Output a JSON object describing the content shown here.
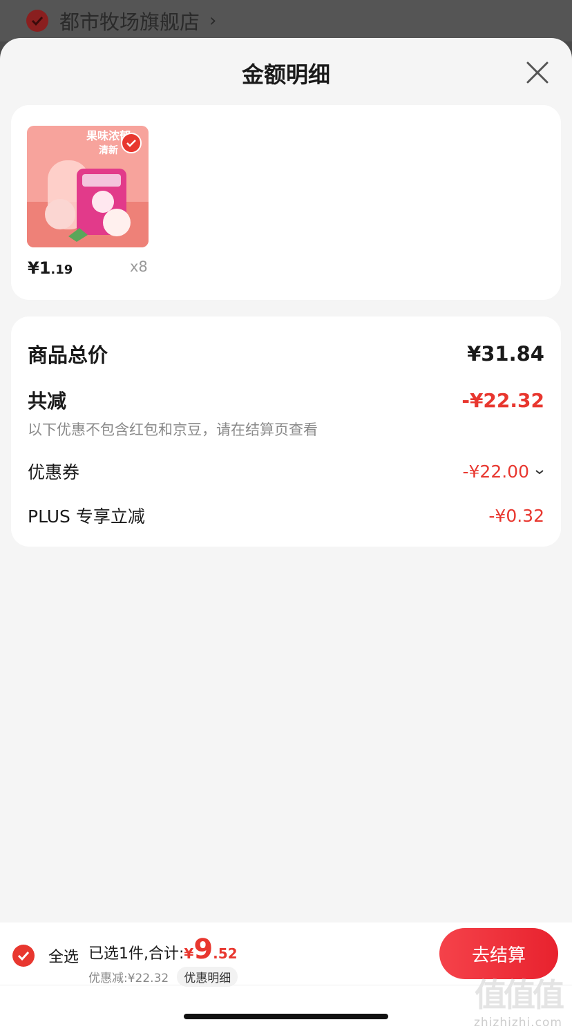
{
  "store": {
    "name": "都市牧场旗舰店"
  },
  "sheet": {
    "title": "金额明细"
  },
  "item": {
    "price_main": "¥1",
    "price_cents": ".19",
    "qty": "x8"
  },
  "summary": {
    "total_label": "商品总价",
    "total_value": "¥31.84",
    "reduce_label": "共减",
    "reduce_value": "-¥22.32",
    "note": "以下优惠不包含红包和京豆，请在结算页查看",
    "coupon_label": "优惠券",
    "coupon_value": "-¥22.00",
    "plus_label": "PLUS 专享立减",
    "plus_value": "-¥0.32"
  },
  "bottom": {
    "select_all": "全选",
    "selected_text": "已选1件,合计:",
    "yen": "¥",
    "total_big": "9",
    "total_small": ".52",
    "discount_text": "优惠减:¥22.32",
    "detail_pill": "优惠明细",
    "checkout": "去结算"
  },
  "watermark": {
    "mark": "值值值",
    "domain": "zhizhizhi.com"
  },
  "colors": {
    "accent": "#e8372f",
    "sheet_bg": "#f5f5f5"
  }
}
